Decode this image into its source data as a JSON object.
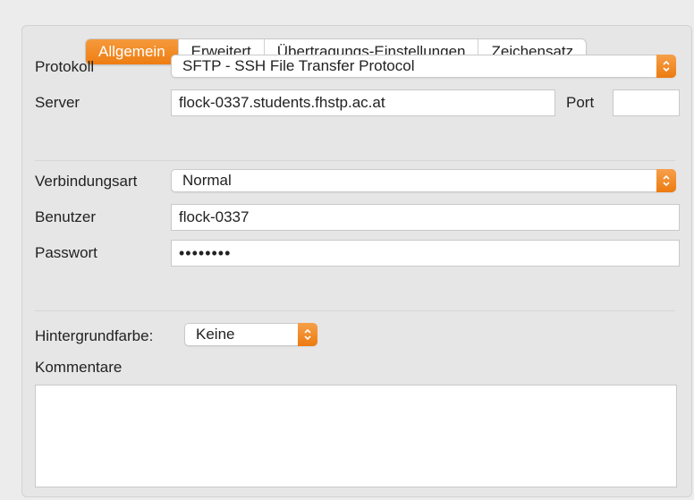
{
  "tabs": [
    {
      "label": "Allgemein",
      "active": true
    },
    {
      "label": "Erweitert",
      "active": false
    },
    {
      "label": "Übertragungs-Einstellungen",
      "active": false
    },
    {
      "label": "Zeichensatz",
      "active": false
    }
  ],
  "connection": {
    "protocol_label": "Protokoll",
    "protocol_value": "SFTP - SSH File Transfer Protocol",
    "server_label": "Server",
    "server_value": "flock-0337.students.fhstp.ac.at",
    "port_label": "Port",
    "port_value": ""
  },
  "login": {
    "type_label": "Verbindungsart",
    "type_value": "Normal",
    "user_label": "Benutzer",
    "user_value": "flock-0337",
    "password_label": "Passwort",
    "password_value": "••••••••"
  },
  "extra": {
    "bgcolor_label": "Hintergrundfarbe:",
    "bgcolor_value": "Keine",
    "comments_label": "Kommentare",
    "comments_value": ""
  },
  "colors": {
    "accent": "#f0871f",
    "panel": "#e6e6e6"
  }
}
